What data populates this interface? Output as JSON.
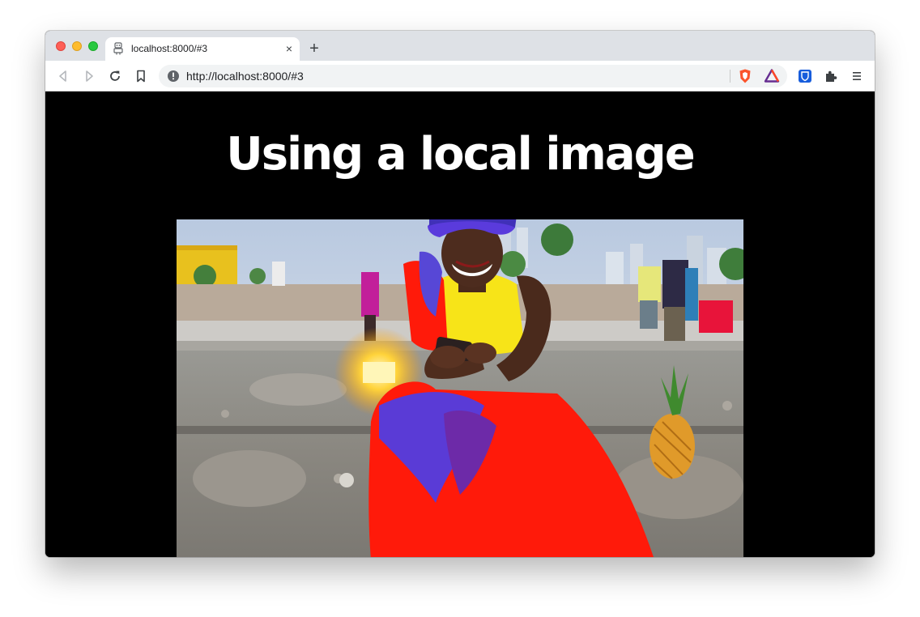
{
  "browser": {
    "tab": {
      "title": "localhost:8000/#3",
      "close_glyph": "×",
      "favicon_icon": "robot-favicon-icon"
    },
    "new_tab_glyph": "+",
    "address_bar": {
      "url": "http://localhost:8000/#3",
      "security_icon": "info-icon"
    },
    "nav_icons": [
      "back-icon",
      "forward-icon",
      "reload-icon",
      "bookmark-icon"
    ],
    "extension_icons": [
      "brave-shields-icon",
      "brave-rewards-icon",
      "bitwarden-icon",
      "extensions-puzzle-icon",
      "menu-icon"
    ],
    "colors": {
      "tabstrip": "#dee1e6",
      "toolbar": "#ffffff",
      "omnibox": "#f1f3f4",
      "brave_orange": "#fb542b",
      "bitwarden_blue": "#175ddc"
    }
  },
  "page": {
    "heading": "Using a local image",
    "background": "#000000",
    "image_subject": "woman-in-colorful-dress-photo"
  }
}
